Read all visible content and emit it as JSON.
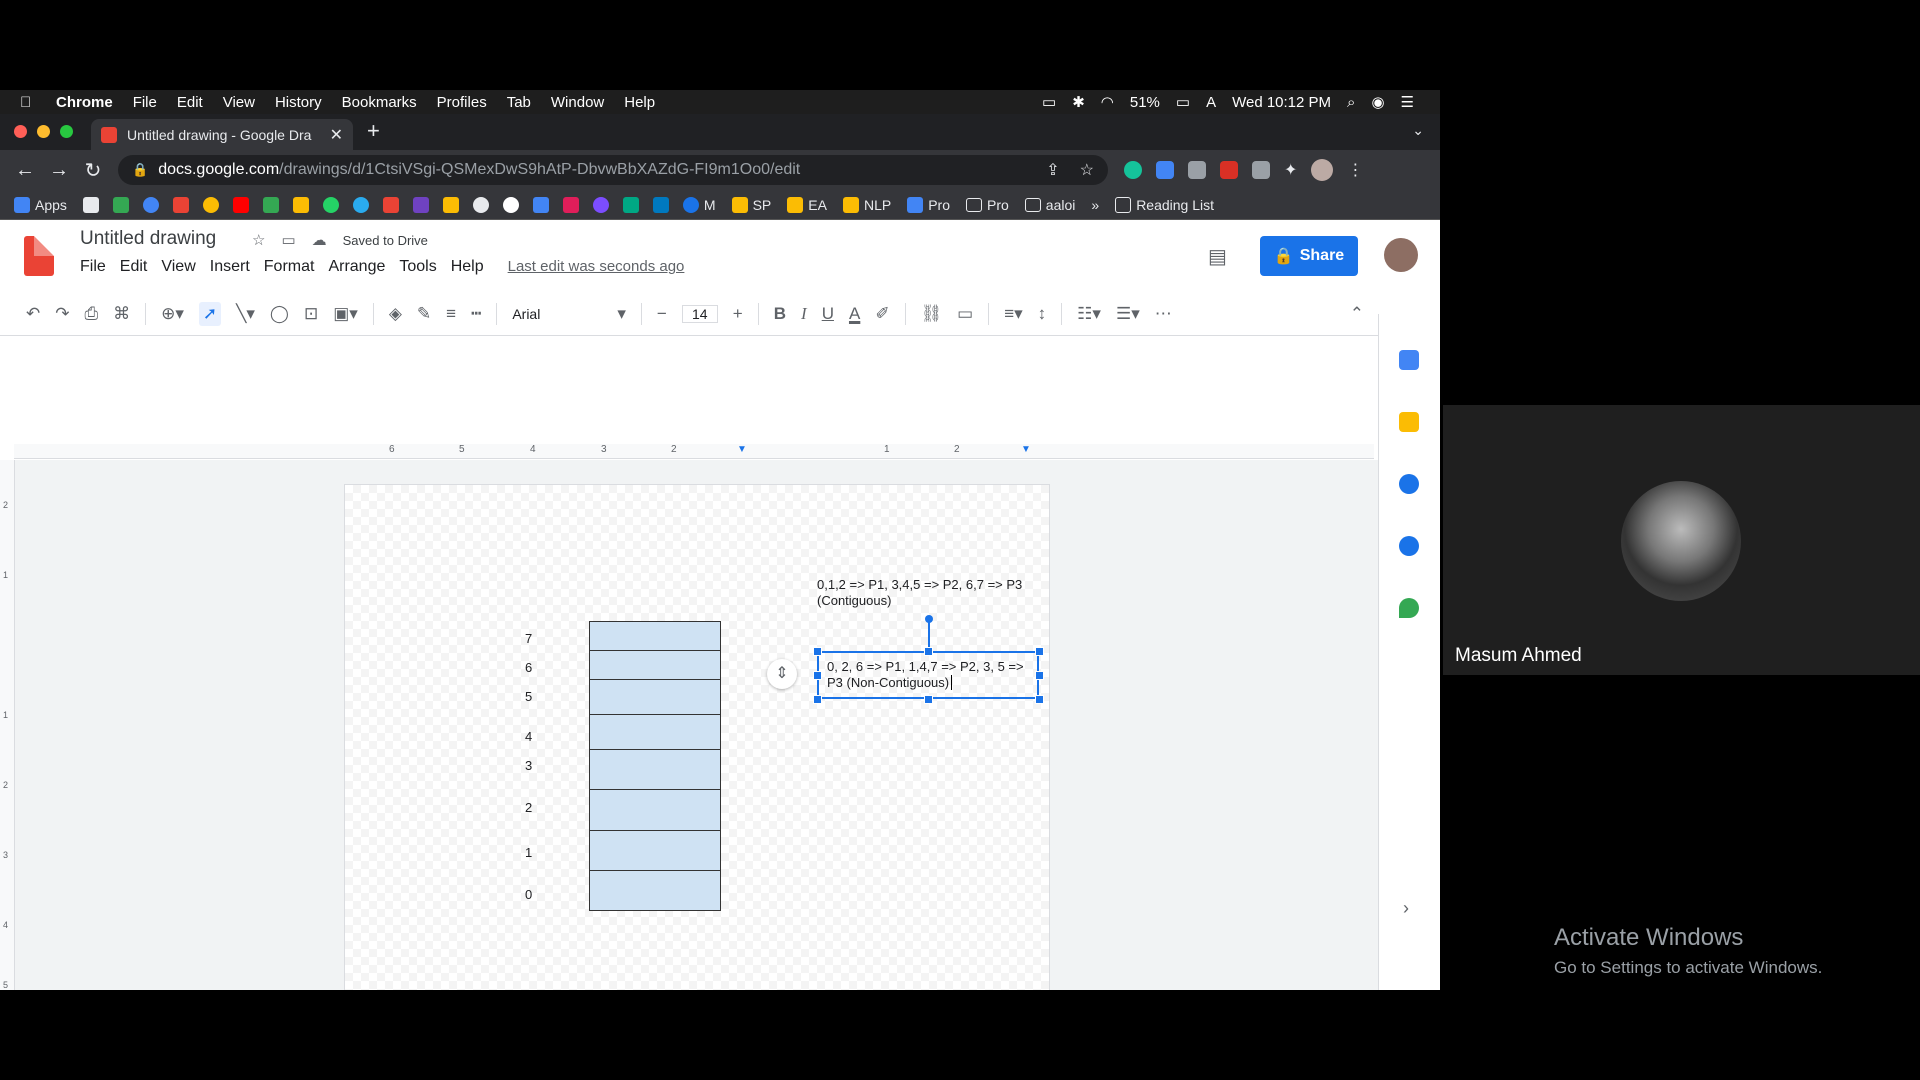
{
  "menubar": {
    "app": "Chrome",
    "items": [
      "File",
      "Edit",
      "View",
      "History",
      "Bookmarks",
      "Profiles",
      "Tab",
      "Window",
      "Help"
    ],
    "battery": "51%",
    "clock": "Wed 10:12 PM"
  },
  "browser": {
    "tab_title": "Untitled drawing - Google Dra",
    "url_host": "docs.google.com",
    "url_path": "/drawings/d/1CtsiVSgi-QSMexDwS9hAtP-DbvwBbXAZdG-FI9m1Oo0/edit"
  },
  "bookmarks": {
    "apps": "Apps",
    "items": [
      "M",
      "SP",
      "EA",
      "NLP",
      "Pro",
      "Pro",
      "aaloi"
    ],
    "more": "»",
    "reading_list": "Reading List"
  },
  "doc": {
    "title": "Untitled drawing",
    "saved": "Saved to Drive",
    "menu": [
      "File",
      "Edit",
      "View",
      "Insert",
      "Format",
      "Arrange",
      "Tools",
      "Help"
    ],
    "last_edit": "Last edit was seconds ago",
    "share": "Share"
  },
  "toolbar": {
    "font": "Arial",
    "font_size": "14"
  },
  "ruler": {
    "h_labels": [
      "6",
      "5",
      "4",
      "3",
      "2",
      "1",
      "1",
      "2"
    ],
    "v_labels": [
      "2",
      "1",
      "1",
      "2",
      "3",
      "4",
      "5"
    ]
  },
  "drawing": {
    "indices": [
      "7",
      "6",
      "5",
      "4",
      "3",
      "2",
      "1",
      "0"
    ],
    "note_contiguous": "0,1,2 => P1, 3,4,5 => P2, 6,7 => P3 (Contiguous)",
    "note_noncontiguous": "0, 2, 6 => P1, 1,4,7 => P2, 3, 5 => P3 (Non-Contiguous)"
  },
  "video": {
    "participant": "Masum Ahmed"
  },
  "watermark": {
    "line1": "Activate Windows",
    "line2": "Go to Settings to activate Windows."
  },
  "colors": {
    "share_blue": "#1a73e8",
    "memory_fill": "#cfe2f3",
    "drawings_red": "#ea4335"
  }
}
